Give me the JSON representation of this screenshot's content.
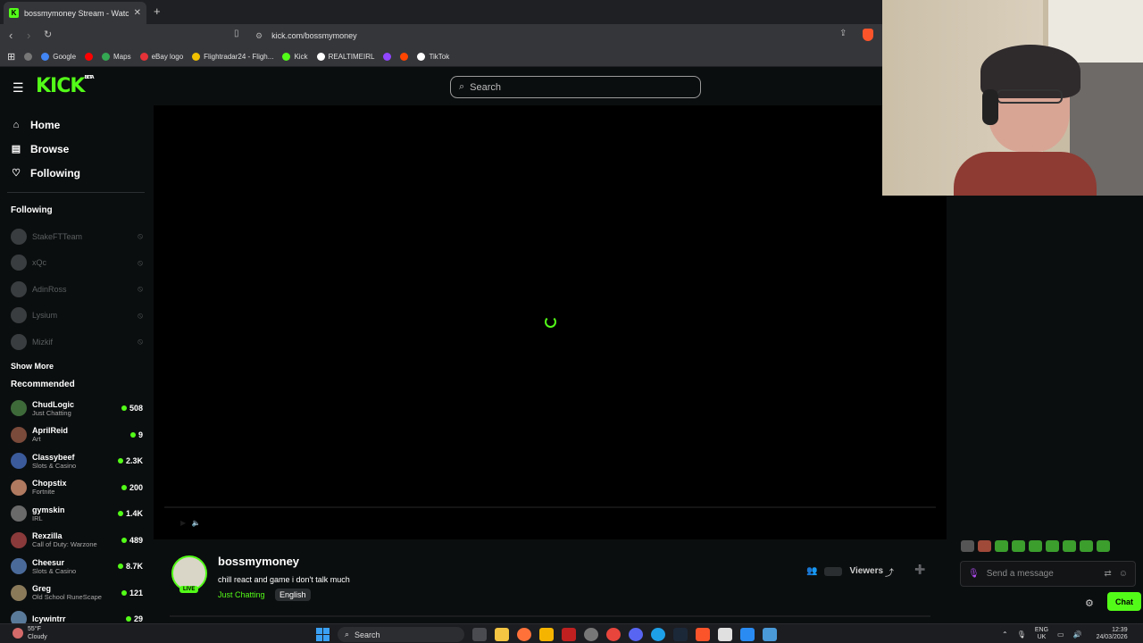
{
  "browser": {
    "tab_title": "bossmymoney Stream - Watch L",
    "tab_favicon": "K",
    "tab_close": "✕",
    "new_tab": "+",
    "url": "kick.com/bossmymoney",
    "bookmarks": [
      {
        "label": "",
        "color": "#777"
      },
      {
        "label": "Google",
        "color": "#4285f4"
      },
      {
        "label": "",
        "color": "#ff0000"
      },
      {
        "label": "Maps",
        "color": "#34a853"
      },
      {
        "label": "eBay logo",
        "color": "#e53238"
      },
      {
        "label": "Flightradar24 - Fligh...",
        "color": "#f0c000"
      },
      {
        "label": "Kick",
        "color": "#53fc18"
      },
      {
        "label": "REALTIMEIRL",
        "color": "#ffffff"
      },
      {
        "label": "",
        "color": "#9146ff"
      },
      {
        "label": "",
        "color": "#ff4500"
      },
      {
        "label": "TikTok",
        "color": "#ffffff"
      }
    ]
  },
  "kick": {
    "logo": "KICK",
    "logo_beta": "BETA",
    "search_placeholder": "Search",
    "nav": [
      {
        "label": "Home",
        "icon": "home-icon",
        "glyph": "⌂"
      },
      {
        "label": "Browse",
        "icon": "browse-icon",
        "glyph": "▤"
      },
      {
        "label": "Following",
        "icon": "heart-icon",
        "glyph": "♡"
      }
    ],
    "following_header": "Following",
    "following": [
      "StakeFTTeam",
      "xQc",
      "AdinRoss",
      "Lysium",
      "Mizkif"
    ],
    "show_more": "Show More",
    "recommended_header": "Recommended",
    "recommended": [
      {
        "name": "ChudLogic",
        "category": "Just Chatting",
        "viewers": "508",
        "color": "#3e6a3a"
      },
      {
        "name": "AprilReid",
        "category": "Art",
        "viewers": "9",
        "color": "#7a4a3a"
      },
      {
        "name": "Classybeef",
        "category": "Slots & Casino",
        "viewers": "2.3K",
        "color": "#3a5a9a"
      },
      {
        "name": "Chopstix",
        "category": "Fortnite",
        "viewers": "200",
        "color": "#b07a60"
      },
      {
        "name": "gymskin",
        "category": "IRL",
        "viewers": "1.4K",
        "color": "#6a6a6a"
      },
      {
        "name": "Rexzilla",
        "category": "Call of Duty: Warzone",
        "viewers": "489",
        "color": "#8a3a3a"
      },
      {
        "name": "Cheesur",
        "category": "Slots & Casino",
        "viewers": "8.7K",
        "color": "#4a6a9a"
      },
      {
        "name": "Greg",
        "category": "Old School RuneScape",
        "viewers": "121",
        "color": "#8a7a5a"
      },
      {
        "name": "Icywintrr",
        "category": "",
        "viewers": "29",
        "color": "#5a7a9a"
      }
    ]
  },
  "stream": {
    "streamer": "bossmymoney",
    "live_badge": "LIVE",
    "title": "chill react and game i don't talk much",
    "category": "Just Chatting",
    "language": "English",
    "viewers_label": "Viewers"
  },
  "chat": {
    "placeholder": "Send a message",
    "send_button": "Chat"
  },
  "taskbar": {
    "temp": "55°F",
    "weather": "Cloudy",
    "search": "Search",
    "lang_top": "ENG",
    "lang_bottom": "UK",
    "time": "12:39",
    "date": "24/03/2026"
  }
}
